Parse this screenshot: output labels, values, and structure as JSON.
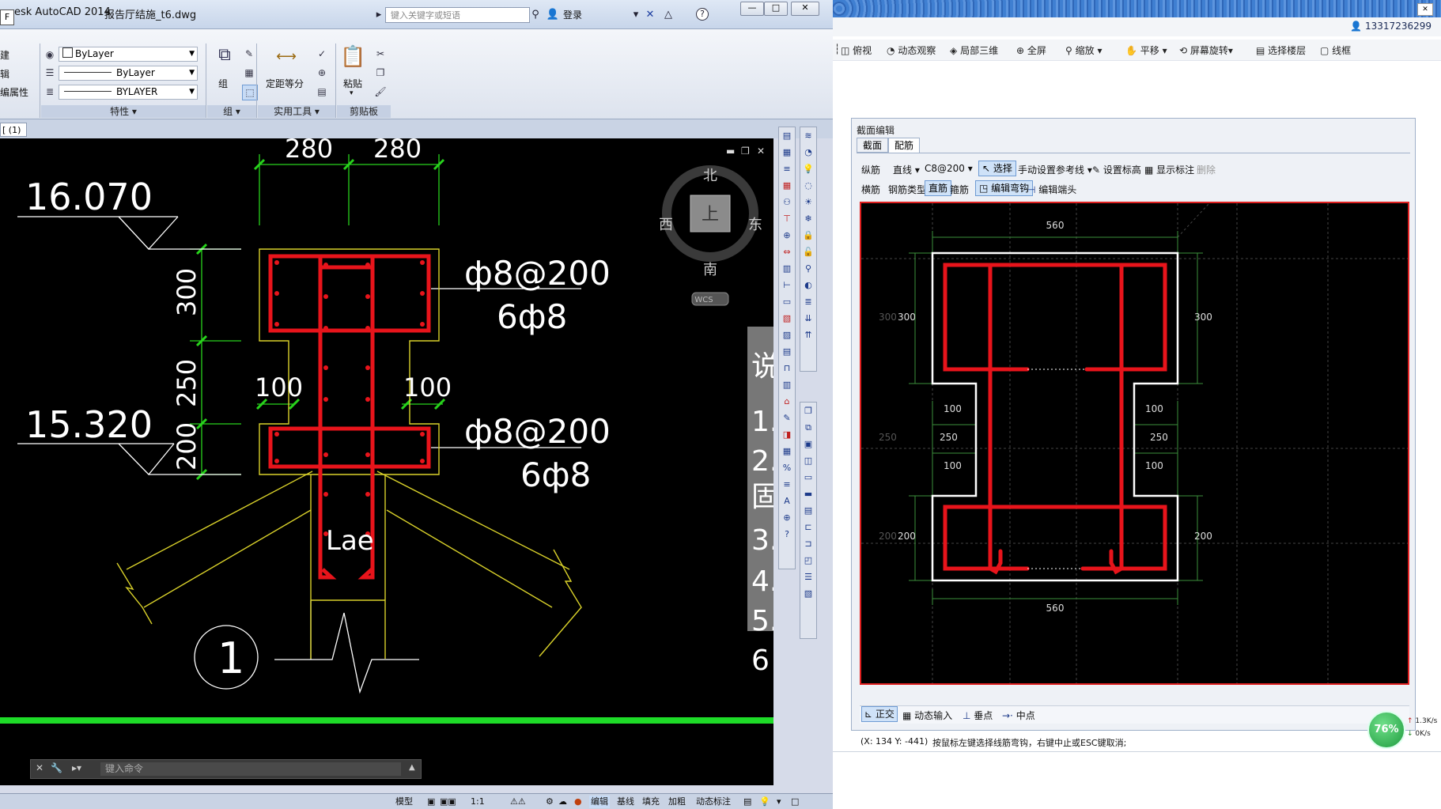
{
  "acad": {
    "title_prefix": "esk AutoCAD 2014",
    "file_name": "报告厅结施_t6.dwg",
    "search_placeholder": "键入关键字或短语",
    "login_label": "登录",
    "left_cut_labels": [
      "建",
      "辑",
      "编属性"
    ],
    "layer_combo": "ByLayer",
    "linetype_combo": "ByLayer",
    "lineweight_combo": "BYLAYER",
    "panel_properties": "特性",
    "panel_group": "组",
    "group_button": "组",
    "measure_button": "定距等分",
    "panel_utilities": "实用工具",
    "paste_button": "粘贴",
    "panel_clipboard": "剪贴板",
    "doc_tab": "[ (1)",
    "cmd_placeholder": "键入命令",
    "viewcube": {
      "north": "北",
      "south": "南",
      "west": "西",
      "east": "东",
      "top": "上",
      "wcs": "WCS"
    },
    "drawing": {
      "dims_top": [
        "280",
        "280"
      ],
      "elev_1": "16.070",
      "elev_2": "15.320",
      "dim_300": "300",
      "dim_250": "250",
      "dim_200": "200",
      "dim_100_left": "100",
      "dim_100_right": "100",
      "rebar_top_1": "ф8@200",
      "rebar_top_2": "6ф8",
      "rebar_bottom_1": "ф8@200",
      "rebar_bottom_2": "6ф8",
      "lae": "Lae",
      "detail_no": "1",
      "side_notes": [
        "说",
        "1.",
        "2.",
        "固",
        "3.",
        "4.",
        "5.",
        "6"
      ]
    },
    "status": [
      "模型",
      "1:1",
      "编辑",
      "基线",
      "填充",
      "加粗",
      "动态标注"
    ]
  },
  "right": {
    "user_id": "13317236299",
    "toolbar": [
      "俯视",
      "动态观察",
      "局部三维",
      "全屏",
      "缩放",
      "平移",
      "屏幕旋转",
      "选择楼层",
      "线框"
    ],
    "dialog": {
      "title": "截面编辑",
      "tabs": [
        "截面",
        "配筋"
      ],
      "row1": {
        "longitudinal": "纵筋",
        "line_type": "直线",
        "rebar_spec": "C8@200",
        "select": "选择",
        "manual_ref": "手动设置参考线",
        "set_label": "设置标高",
        "show_label": "显示标注",
        "delete": "删除"
      },
      "row2": {
        "transverse": "横筋",
        "rebar_type_label": "钢筋类型:",
        "straight": "直筋",
        "stirrup": "箍筋",
        "edit_hook": "编辑弯钩",
        "edit_end": "编辑端头"
      },
      "canvas": {
        "top_dim": "560",
        "bottom_dim": "560",
        "left_300": "300",
        "left_300_ghost": "300",
        "left_100a": "100",
        "left_250": "250",
        "left_250_ghost": "250",
        "left_100b": "100",
        "left_200": "200",
        "left_200_ghost": "200",
        "right_300": "300",
        "right_100a": "100",
        "right_250": "250",
        "right_100b": "100",
        "right_200": "200"
      },
      "status": {
        "ortho": "正交",
        "dynamic_input": "动态输入",
        "perpendicular": "垂点",
        "midpoint": "中点"
      },
      "coords": "(X: 134 Y: -441)",
      "hint": "按鼠标左键选择线筋弯钩，右键中止或ESC键取消;"
    },
    "net": {
      "percent": "76%",
      "up": "1.3K/s",
      "down": "0K/s"
    }
  },
  "colors": {
    "rebar": "#e8141b",
    "outline_yellow": "#d9d12a",
    "dim_green": "#28d21c"
  }
}
